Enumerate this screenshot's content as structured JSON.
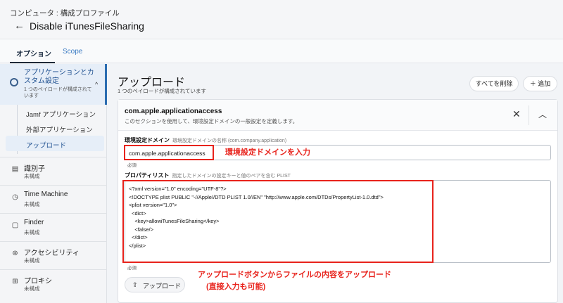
{
  "header": {
    "breadcrumb": "コンピュータ : 構成プロファイル",
    "title": "Disable iTunesFileSharing",
    "back_icon": "arrow-left-icon"
  },
  "tabs": [
    {
      "label": "オプション",
      "active": true
    },
    {
      "label": "Scope",
      "active": false
    }
  ],
  "sidebar": {
    "selected": {
      "title": "アプリケーションとカスタム設定",
      "subtitle": "1 つのペイロードが構成されています",
      "icon": "gear-icon"
    },
    "subitems": [
      {
        "label": "Jamf アプリケーション"
      },
      {
        "label": "外部アプリケーション"
      },
      {
        "label": "アップロード",
        "active": true
      }
    ],
    "items": [
      {
        "name": "識別子",
        "status": "未構成",
        "icon": "id-card-icon"
      },
      {
        "name": "Time Machine",
        "status": "未構成",
        "icon": "history-icon"
      },
      {
        "name": "Finder",
        "status": "未構成",
        "icon": "finder-icon"
      },
      {
        "name": "アクセシビリティ",
        "status": "未構成",
        "icon": "accessibility-icon"
      },
      {
        "name": "プロキシ",
        "status": "未構成",
        "icon": "network-icon"
      }
    ]
  },
  "main": {
    "title": "アップロード",
    "subtitle": "1 つのペイロードが構成されています",
    "delete_all_label": "すべてを削除",
    "add_label": "追加",
    "card": {
      "title": "com.apple.applicationaccess",
      "description": "このセクションを使用して、環境設定ドメインの一般設定を定義します。",
      "domain_label": "環境設定ドメイン",
      "domain_hint": "環境設定ドメインの名称 (com.company.application)",
      "domain_value": "com.apple.applicationaccess",
      "required_label": "必須",
      "plist_label": "プロパティリスト",
      "plist_hint": "指定したドメインの設定キーと値のペアを含む PLIST",
      "plist_lines": [
        "<?xml version=\"1.0\" encoding=\"UTF-8\"?>",
        "<!DOCTYPE plist PUBLIC \"-//Apple//DTD PLIST 1.0//EN\" \"http://www.apple.com/DTDs/PropertyList-1.0.dtd\">",
        "<plist version=\"1.0\">",
        "  <dict>",
        "    <key>allowiTunesFileSharing</key>",
        "    <false/>",
        "  </dict>",
        "</plist>"
      ],
      "upload_label": "アップロード"
    }
  },
  "annotations": {
    "domain_note": "環境設定ドメインを入力",
    "upload_note_line1": "アップロードボタンからファイルの内容をアップロード",
    "upload_note_line2": "(直接入力も可能)",
    "color": "#e8231c"
  }
}
